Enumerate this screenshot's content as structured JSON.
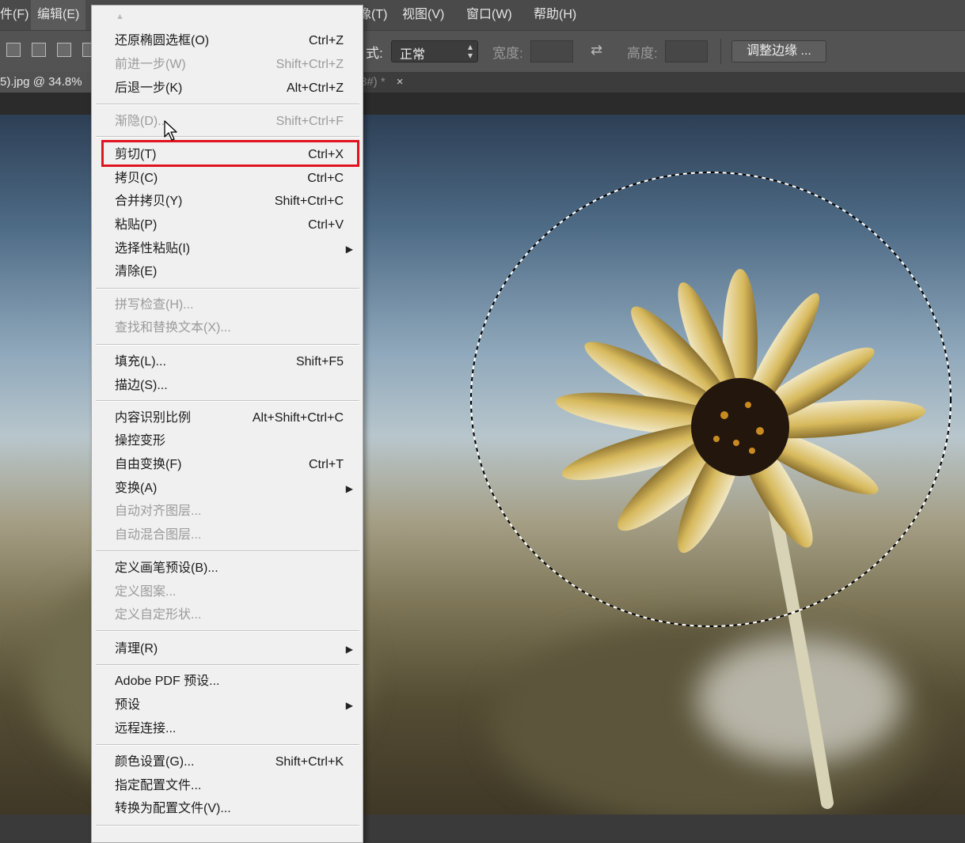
{
  "menubar": {
    "items": [
      "件(F)",
      "编辑(E)",
      "像(T)",
      "视图(V)",
      "窗口(W)",
      "帮助(H)"
    ]
  },
  "options": {
    "style_label": "式:",
    "style_value": "正常",
    "width_label": "宽度:",
    "height_label": "高度:",
    "refine_button": "调整边缘 ..."
  },
  "tabs": {
    "active": "5).jpg @ 34.8%",
    "other": "8#) *",
    "close": "×"
  },
  "edit_menu": {
    "items": [
      {
        "label": "还原椭圆选框(O)",
        "shortcut": "Ctrl+Z",
        "enabled": true
      },
      {
        "label": "前进一步(W)",
        "shortcut": "Shift+Ctrl+Z",
        "enabled": false
      },
      {
        "label": "后退一步(K)",
        "shortcut": "Alt+Ctrl+Z",
        "enabled": true
      },
      {
        "label": "渐隐(D)...",
        "shortcut": "Shift+Ctrl+F",
        "enabled": false
      },
      {
        "label": "剪切(T)",
        "shortcut": "Ctrl+X",
        "enabled": true,
        "highlighted": true
      },
      {
        "label": "拷贝(C)",
        "shortcut": "Ctrl+C",
        "enabled": true
      },
      {
        "label": "合并拷贝(Y)",
        "shortcut": "Shift+Ctrl+C",
        "enabled": true
      },
      {
        "label": "粘贴(P)",
        "shortcut": "Ctrl+V",
        "enabled": true
      },
      {
        "label": "选择性粘贴(I)",
        "shortcut": "",
        "enabled": true,
        "submenu": true
      },
      {
        "label": "清除(E)",
        "shortcut": "",
        "enabled": true
      },
      {
        "label": "拼写检查(H)...",
        "shortcut": "",
        "enabled": false
      },
      {
        "label": "查找和替换文本(X)...",
        "shortcut": "",
        "enabled": false
      },
      {
        "label": "填充(L)...",
        "shortcut": "Shift+F5",
        "enabled": true
      },
      {
        "label": "描边(S)...",
        "shortcut": "",
        "enabled": true
      },
      {
        "label": "内容识别比例",
        "shortcut": "Alt+Shift+Ctrl+C",
        "enabled": true
      },
      {
        "label": "操控变形",
        "shortcut": "",
        "enabled": true
      },
      {
        "label": "自由变换(F)",
        "shortcut": "Ctrl+T",
        "enabled": true
      },
      {
        "label": "变换(A)",
        "shortcut": "",
        "enabled": true,
        "submenu": true
      },
      {
        "label": "自动对齐图层...",
        "shortcut": "",
        "enabled": false
      },
      {
        "label": "自动混合图层...",
        "shortcut": "",
        "enabled": false
      },
      {
        "label": "定义画笔预设(B)...",
        "shortcut": "",
        "enabled": true
      },
      {
        "label": "定义图案...",
        "shortcut": "",
        "enabled": false
      },
      {
        "label": "定义自定形状...",
        "shortcut": "",
        "enabled": false
      },
      {
        "label": "清理(R)",
        "shortcut": "",
        "enabled": true,
        "submenu": true
      },
      {
        "label": "Adobe PDF 预设...",
        "shortcut": "",
        "enabled": true
      },
      {
        "label": "预设",
        "shortcut": "",
        "enabled": true,
        "submenu": true
      },
      {
        "label": "远程连接...",
        "shortcut": "",
        "enabled": true
      },
      {
        "label": "颜色设置(G)...",
        "shortcut": "Shift+Ctrl+K",
        "enabled": true
      },
      {
        "label": "指定配置文件...",
        "shortcut": "",
        "enabled": true
      },
      {
        "label": "转换为配置文件(V)...",
        "shortcut": "",
        "enabled": true
      }
    ]
  },
  "colors": {
    "highlight_box": "#e0141e",
    "menu_bg": "#f0f0f0",
    "disabled_text": "#9b9b9b"
  },
  "icons": [
    "selection-mode-icons",
    "submenu-arrow-icon",
    "swap-icon",
    "mouse-cursor-icon",
    "marching-ants-selection"
  ]
}
